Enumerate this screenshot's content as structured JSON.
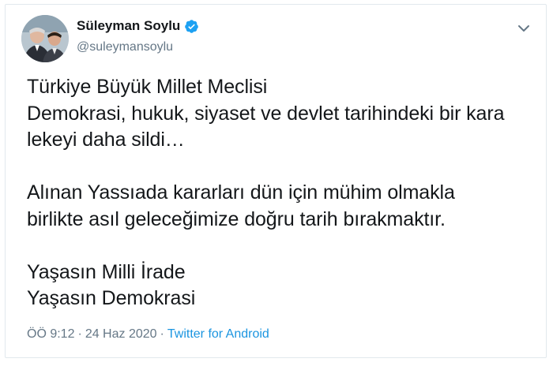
{
  "tweet": {
    "author_name": "Süleyman Soylu",
    "author_handle": "@suleymansoylu",
    "text_lines": [
      "Türkiye Büyük Millet Meclisi",
      "Demokrasi, hukuk, siyaset ve devlet tarihindeki bir kara",
      "lekeyi daha sildi…",
      "",
      "Alınan Yassıada kararları dün için mühim olmakla",
      "birlikte asıl geleceğimize doğru tarih bırakmaktır.",
      "",
      "Yaşasın Milli İrade",
      "Yaşasın Demokrasi"
    ],
    "time": "ÖÖ 9:12",
    "separator": "·",
    "date": "24 Haz 2020",
    "source": "Twitter for Android"
  },
  "icons": {
    "verified": "verified-badge-icon",
    "menu": "chevron-down-icon"
  },
  "colors": {
    "verified_blue": "#1da1f2",
    "link_blue": "#1b95e0",
    "muted_gray": "#657786",
    "text": "#14171a",
    "border": "#e1e8ed"
  }
}
